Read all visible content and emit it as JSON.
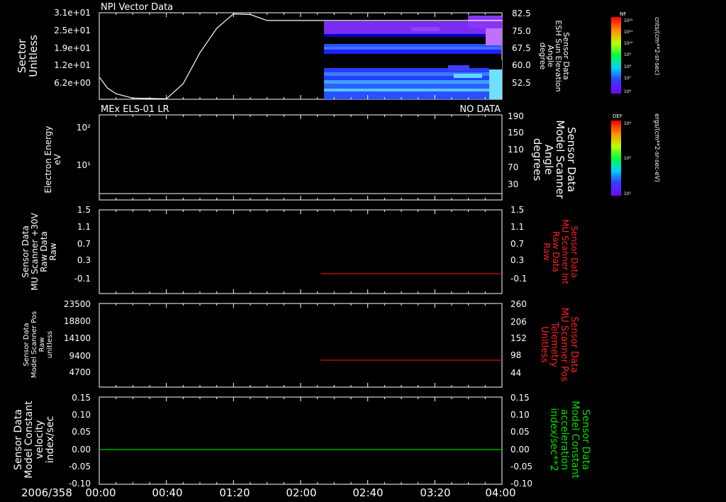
{
  "colors": {
    "axis": "#ffffff",
    "red_trace": "#e01010",
    "green_trace": "#00cc00",
    "red_label": "#ff2020",
    "green_label": "#00dd00",
    "background": "#000000"
  },
  "colorbars": [
    {
      "title": "NF",
      "unit_label": "cnts/(cm**2-sr-sec)",
      "tick_labels": [
        "10¹²",
        "10¹¹",
        "10¹⁰",
        "10⁹",
        "10⁸",
        "10⁷",
        "10⁶"
      ]
    },
    {
      "title": "DEF",
      "unit_label": "ergs/(cm**2-sr-sec-eV)",
      "tick_labels": [
        "10⁴",
        "10²",
        "10¹"
      ]
    }
  ],
  "time_axis": {
    "date_label": "2006/358",
    "ticks": [
      "00:00",
      "00:40",
      "01:20",
      "02:00",
      "02:40",
      "03:20",
      "04:00"
    ]
  },
  "chart_data": [
    {
      "type": "heatmap",
      "title": "NPI Vector Data",
      "ylabel": [
        "Sector",
        "Unitless"
      ],
      "y_ticks": [
        "3.1e+01",
        "2.5e+01",
        "1.9e+01",
        "1.2e+01",
        "6.2e+00"
      ],
      "y2label": [
        "Sensor Data",
        "ESH Sun Elevation",
        "Angle",
        "degree"
      ],
      "y2_ticks": [
        "82.5",
        "75.0",
        "67.5",
        "60.0",
        "52.5"
      ],
      "y2lim": [
        45,
        82.5
      ],
      "line": {
        "name": "ESH Sun Elevation Angle",
        "x_minutes": [
          0,
          5,
          10,
          20,
          40,
          50,
          60,
          70,
          80,
          90,
          100,
          110,
          115,
          120,
          130,
          140,
          150,
          160,
          170,
          180,
          190,
          200,
          210,
          220,
          240
        ],
        "y": [
          55.0,
          50.0,
          47.5,
          45.5,
          45.2,
          52,
          66,
          77,
          83.5,
          83.2,
          80.5,
          80.5,
          80.5,
          80.5,
          80.5,
          80.5,
          80.5,
          80.5,
          80.5,
          80.5,
          80.5,
          80.5,
          80.5,
          80.5,
          80.5
        ]
      },
      "spectrogram_start_minutes": 135,
      "spectrogram_end_minutes": 240
    },
    {
      "type": "line",
      "title": "MEx ELS-01 LR",
      "status": "NO DATA",
      "ylabel": [
        "Electron Energy",
        "eV"
      ],
      "y_ticks": [
        "10²",
        "10¹"
      ],
      "y2label": [
        "Sensor Data",
        "Model Scanner",
        "Angle",
        "degrees"
      ],
      "y2_ticks": [
        "190",
        "150",
        "110",
        "70",
        "30"
      ],
      "y2lim": [
        0,
        190
      ],
      "series": [
        {
          "x_minutes": [
            0,
            240
          ],
          "y": [
            5,
            5
          ]
        }
      ]
    },
    {
      "type": "line",
      "ylabel": [
        "Sensor Data",
        "MU Scanner +30V",
        "Raw Data",
        "Raw"
      ],
      "y_ticks": [
        "1.5",
        "1.1",
        "0.7",
        "0.3",
        "-0.1"
      ],
      "ylim": [
        -0.3,
        1.5
      ],
      "y2label": [
        "Sensor Data",
        "MU Scanner Int",
        "Raw Data",
        "Raw"
      ],
      "y2_ticks": [
        "1.5",
        "1.1",
        "0.7",
        "0.3",
        "-0.1"
      ],
      "series": [
        {
          "x_minutes": [
            132,
            240
          ],
          "y": [
            0.0,
            0.0
          ]
        }
      ]
    },
    {
      "type": "line",
      "ylabel": [
        "Sensor Data",
        "Model Scanner Pos",
        "Raw",
        "unitless"
      ],
      "y_ticks": [
        "23500",
        "18800",
        "14100",
        "9400",
        "4700"
      ],
      "y2label": [
        "Sensor Data",
        "MU Scanner Pos",
        "Telemetry",
        "Unitless"
      ],
      "y2_ticks": [
        "260",
        "206",
        "152",
        "98",
        "44"
      ],
      "y2lim": [
        0,
        260
      ],
      "series": [
        {
          "x_minutes": [
            132,
            240
          ],
          "y2": [
            86,
            86
          ]
        }
      ]
    },
    {
      "type": "line",
      "ylabel": [
        "Sensor Data",
        "Model Constant",
        "velocity",
        "index/sec"
      ],
      "y_ticks": [
        "0.15",
        "0.10",
        "0.05",
        "0.00",
        "-0.05",
        "-0.10"
      ],
      "ylim": [
        -0.1,
        0.15
      ],
      "y2label": [
        "Sensor Data",
        "Model Constant",
        "acceleration",
        "index/sec**2"
      ],
      "y2_ticks": [
        "0.15",
        "0.10",
        "0.05",
        "0.00",
        "-0.05",
        "-0.10"
      ],
      "series": [
        {
          "x_minutes": [
            0,
            240
          ],
          "y": [
            0.0,
            0.0
          ]
        }
      ]
    }
  ]
}
